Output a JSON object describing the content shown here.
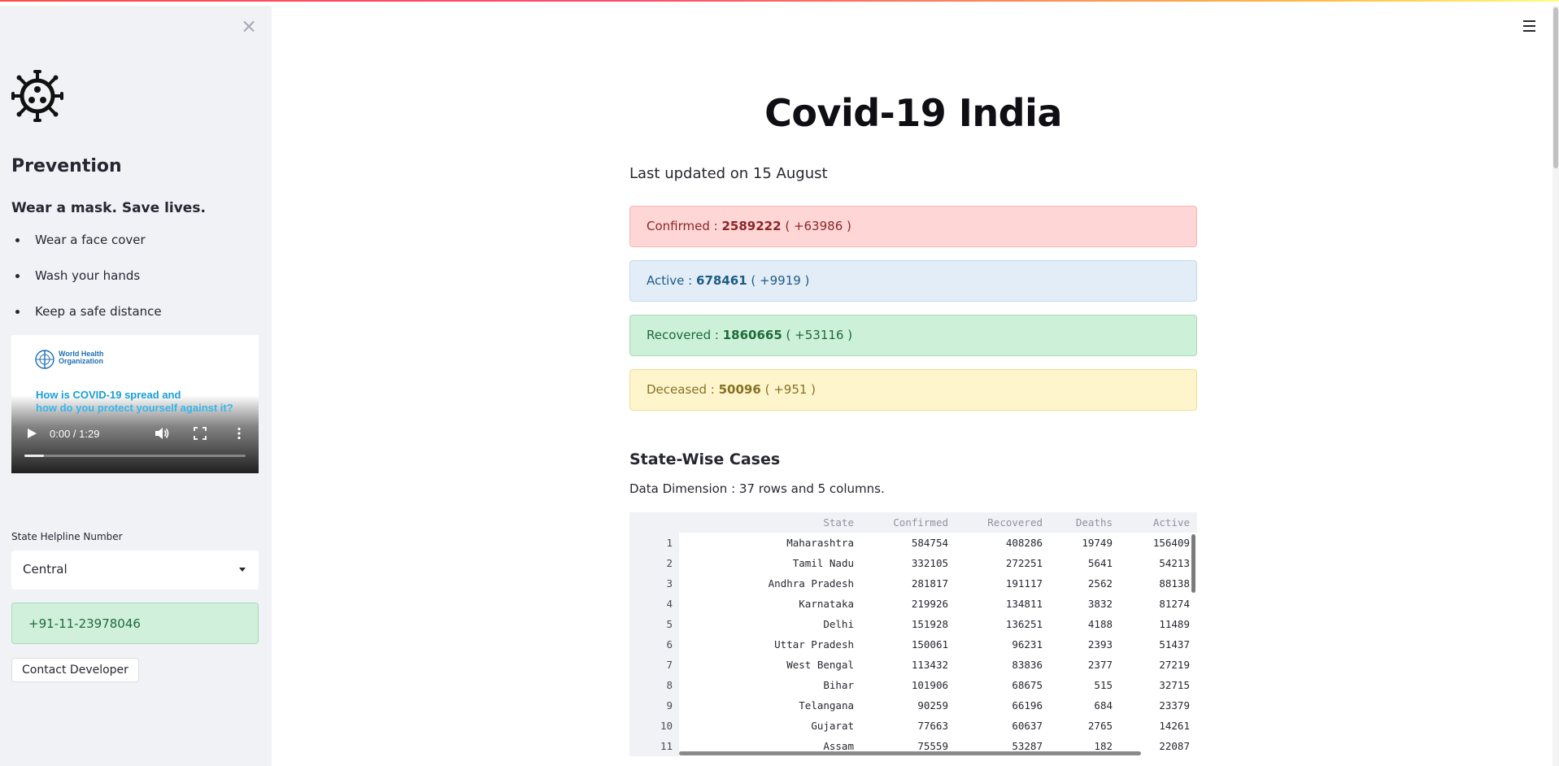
{
  "sidebar": {
    "heading": "Prevention",
    "subheading": "Wear a mask. Save lives.",
    "tips": [
      "Wear a face cover",
      "Wash your hands",
      "Keep a safe distance"
    ],
    "video": {
      "org_line1": "World Health",
      "org_line2": "Organization",
      "title_line1": "How is COVID-19 spread and",
      "title_line2": "how do you protect yourself against it?",
      "time": "0:00 / 1:29",
      "progress": 0
    },
    "helpline_label": "State Helpline Number",
    "helpline_selected": "Central",
    "helpline_number": "+91-11-23978046",
    "contact_button": "Contact Developer"
  },
  "main": {
    "title": "Covid-19 India",
    "updated": "Last updated on 15 August",
    "stats": {
      "confirmed": {
        "label": "Confirmed :",
        "value": "2589222",
        "delta": "( +63986 )"
      },
      "active": {
        "label": "Active :",
        "value": "678461",
        "delta": "( +9919 )"
      },
      "recovered": {
        "label": "Recovered :",
        "value": "1860665",
        "delta": "( +53116 )"
      },
      "deceased": {
        "label": "Deceased :",
        "value": "50096",
        "delta": "( +951 )"
      }
    },
    "section_title": "State-Wise Cases",
    "dimension": "Data Dimension : 37 rows and 5 columns.",
    "table": {
      "columns": [
        "State",
        "Confirmed",
        "Recovered",
        "Deaths",
        "Active"
      ],
      "rows": [
        [
          "1",
          "Maharashtra",
          "584754",
          "408286",
          "19749",
          "156409"
        ],
        [
          "2",
          "Tamil Nadu",
          "332105",
          "272251",
          "5641",
          "54213"
        ],
        [
          "3",
          "Andhra Pradesh",
          "281817",
          "191117",
          "2562",
          "88138"
        ],
        [
          "4",
          "Karnataka",
          "219926",
          "134811",
          "3832",
          "81274"
        ],
        [
          "5",
          "Delhi",
          "151928",
          "136251",
          "4188",
          "11489"
        ],
        [
          "6",
          "Uttar Pradesh",
          "150061",
          "96231",
          "2393",
          "51437"
        ],
        [
          "7",
          "West Bengal",
          "113432",
          "83836",
          "2377",
          "27219"
        ],
        [
          "8",
          "Bihar",
          "101906",
          "68675",
          "515",
          "32715"
        ],
        [
          "9",
          "Telangana",
          "90259",
          "66196",
          "684",
          "23379"
        ],
        [
          "10",
          "Gujarat",
          "77663",
          "60637",
          "2765",
          "14261"
        ],
        [
          "11",
          "Assam",
          "75559",
          "53287",
          "182",
          "22087"
        ]
      ]
    }
  },
  "icons": {
    "close": "close-icon",
    "logo": "virus-icon",
    "menu": "hamburger-menu-icon"
  },
  "colors": {
    "sidebar_bg": "#f0f2f6",
    "confirmed": "#ffd6d6",
    "active": "#e2edf8",
    "recovered": "#cdf0d8",
    "deceased": "#fff5cc"
  }
}
